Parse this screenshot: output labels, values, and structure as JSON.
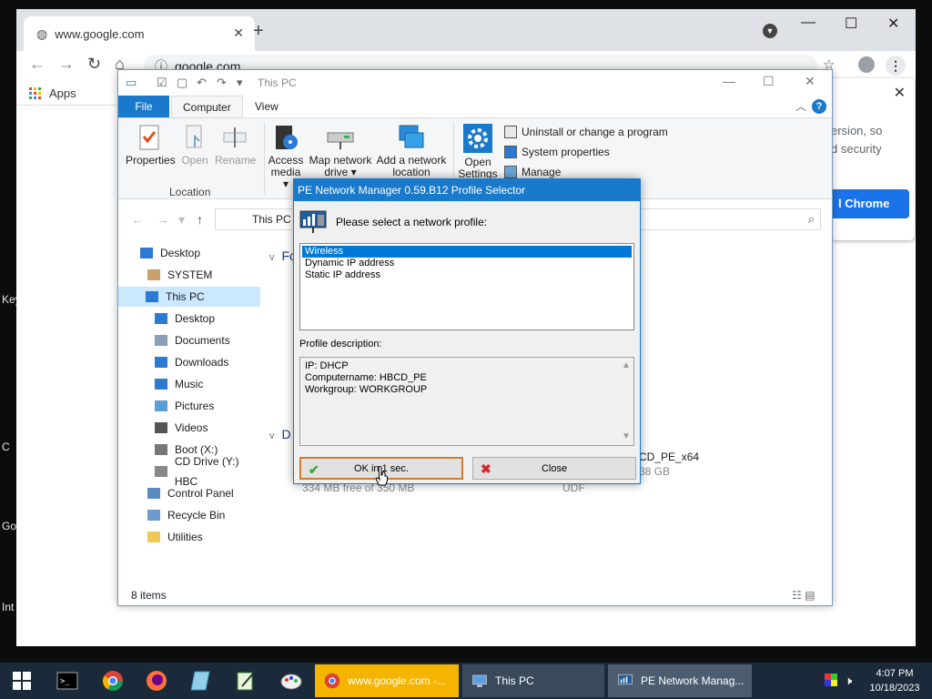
{
  "desktop": {
    "fragments": [
      "Key",
      "C",
      "Go",
      "Int"
    ]
  },
  "chrome": {
    "tab_title": "www.google.com",
    "tab_close": "✕",
    "new_tab": "+",
    "url": "google.com",
    "bookmarks_apps": "Apps",
    "popup_text_line1": "ersion, so",
    "popup_text_line2": "d security",
    "popup_button": "l Chrome",
    "accent": "#1a73e8"
  },
  "explorer": {
    "title": "This PC",
    "tabs": {
      "file": "File",
      "computer": "Computer",
      "view": "View"
    },
    "ribbon": {
      "properties": "Properties",
      "open": "Open",
      "rename": "Rename",
      "group_location": "Location",
      "access_media_1": "Access",
      "access_media_2": "media ▾",
      "map_drive_1": "Map network",
      "map_drive_2": "drive ▾",
      "add_location_1": "Add a network",
      "add_location_2": "location",
      "open_settings_1": "Open",
      "open_settings_2": "Settings",
      "uninstall": "Uninstall or change a program",
      "system_properties": "System properties",
      "manage": "Manage"
    },
    "address": "This PC",
    "tree": [
      "Desktop",
      "SYSTEM",
      "This PC",
      "Desktop",
      "Documents",
      "Downloads",
      "Music",
      "Pictures",
      "Videos",
      "Boot (X:)",
      "CD Drive (Y:) HBC",
      "Control Panel",
      "Recycle Bin",
      "Utilities"
    ],
    "content": {
      "section_folders": "Fo",
      "section_devices": "D",
      "drive_name": "CD_PE_x64",
      "drive_size": "38 GB",
      "drive_fs": "UDF",
      "drive_free": "334 MB free of 350 MB"
    },
    "status": "8 items"
  },
  "dialog": {
    "title": "PE Network Manager 0.59.B12 Profile Selector",
    "prompt": "Please select a network profile:",
    "profiles": [
      "Wireless",
      "Dynamic IP address",
      "Static IP address"
    ],
    "selected_profile": "Wireless",
    "description_label": "Profile description:",
    "description_lines": [
      "IP: DHCP",
      "Computername: HBCD_PE",
      "Workgroup: WORKGROUP"
    ],
    "ok_button": "OK in 1 sec.",
    "close_button": "Close"
  },
  "taskbar": {
    "tasks": {
      "chrome": "www.google.com -...",
      "explorer": "This PC",
      "penetwork": "PE Network Manag..."
    },
    "time": "4:07 PM",
    "date": "10/18/2023"
  }
}
